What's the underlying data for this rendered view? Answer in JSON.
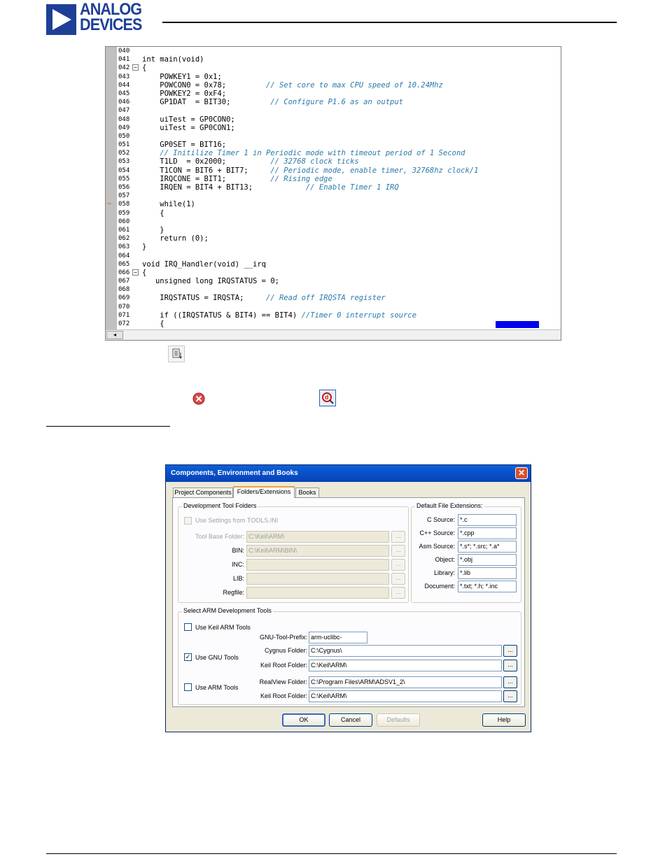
{
  "header": {
    "logo_line1": "ANALOG",
    "logo_line2": "DEVICES",
    "brand_color": "#1e3f96"
  },
  "editor": {
    "lines": [
      {
        "n": "040",
        "fold": "",
        "marker": "",
        "code": ""
      },
      {
        "n": "041",
        "fold": "",
        "marker": "",
        "code": "int main(void)"
      },
      {
        "n": "042",
        "fold": "−",
        "marker": "",
        "code": "{"
      },
      {
        "n": "043",
        "fold": "",
        "marker": "",
        "code": "    POWKEY1 = 0x1;"
      },
      {
        "n": "044",
        "fold": "",
        "marker": "",
        "code": "    POWCON0 = 0x78;         // Set core to max CPU speed of 10.24Mhz"
      },
      {
        "n": "045",
        "fold": "",
        "marker": "",
        "code": "    POWKEY2 = 0xF4;"
      },
      {
        "n": "046",
        "fold": "",
        "marker": "",
        "code": "    GP1DAT  = BIT30;         // Configure P1.6 as an output"
      },
      {
        "n": "047",
        "fold": "",
        "marker": "",
        "code": ""
      },
      {
        "n": "048",
        "fold": "",
        "marker": "",
        "code": "    uiTest = GP0CON0;"
      },
      {
        "n": "049",
        "fold": "",
        "marker": "",
        "code": "    uiTest = GP0CON1;"
      },
      {
        "n": "050",
        "fold": "",
        "marker": "",
        "code": ""
      },
      {
        "n": "051",
        "fold": "",
        "marker": "",
        "code": "    GP0SET = BIT16;"
      },
      {
        "n": "052",
        "fold": "",
        "marker": "",
        "code": "    // Initilize Timer 1 in Periodic mode with timeout period of 1 Second"
      },
      {
        "n": "053",
        "fold": "",
        "marker": "",
        "code": "    T1LD  = 0x2000;          // 32768 clock ticks"
      },
      {
        "n": "054",
        "fold": "",
        "marker": "",
        "code": "    T1CON = BIT6 + BIT7;     // Periodic mode, enable timer, 32768hz clock/1"
      },
      {
        "n": "055",
        "fold": "",
        "marker": "",
        "code": "    IRQCONE = BIT1;          // Rising edge"
      },
      {
        "n": "056",
        "fold": "",
        "marker": "",
        "code": "    IRQEN = BIT4 + BIT13;            // Enable Timer 1 IRQ"
      },
      {
        "n": "057",
        "fold": "",
        "marker": "",
        "code": ""
      },
      {
        "n": "058",
        "fold": "",
        "marker": "⇨",
        "code": "    while(1)"
      },
      {
        "n": "059",
        "fold": "",
        "marker": "",
        "code": "    {"
      },
      {
        "n": "060",
        "fold": "",
        "marker": "",
        "code": ""
      },
      {
        "n": "061",
        "fold": "",
        "marker": "",
        "code": "    }"
      },
      {
        "n": "062",
        "fold": "",
        "marker": "",
        "code": "    return (0);"
      },
      {
        "n": "063",
        "fold": "",
        "marker": "",
        "code": "}"
      },
      {
        "n": "064",
        "fold": "",
        "marker": "",
        "code": ""
      },
      {
        "n": "065",
        "fold": "",
        "marker": "",
        "code": "void IRQ_Handler(void) __irq"
      },
      {
        "n": "066",
        "fold": "−",
        "marker": "",
        "code": "{"
      },
      {
        "n": "067",
        "fold": "",
        "marker": "",
        "code": "   unsigned long IRQSTATUS = 0;"
      },
      {
        "n": "068",
        "fold": "",
        "marker": "",
        "code": ""
      },
      {
        "n": "069",
        "fold": "",
        "marker": "",
        "code": "    IRQSTATUS = IRQSTA;     // Read off IRQSTA register"
      },
      {
        "n": "070",
        "fold": "",
        "marker": "",
        "code": ""
      },
      {
        "n": "071",
        "fold": "",
        "marker": "",
        "code": "    if ((IRQSTATUS & BIT4) == BIT4) //Timer 0 interrupt source"
      },
      {
        "n": "072",
        "fold": "",
        "marker": "",
        "code": "    {"
      }
    ],
    "scroll_left_glyph": "◂"
  },
  "icons": {
    "list_icon": "list-icon",
    "stop_icon": "stop-icon",
    "debug_icon": "debug-icon"
  },
  "dialog": {
    "title": "Components, Environment and Books",
    "close_glyph": "✕",
    "tabs": [
      "Project Components",
      "Folders/Extensions",
      "Books"
    ],
    "active_tab": 1,
    "dev_folders": {
      "title": "Development Tool Folders",
      "use_settings_label": "Use Settings from TOOLS.INI",
      "rows": [
        {
          "label": "Tool Base Folder:",
          "value": "C:\\Keil\\ARM\\"
        },
        {
          "label": "BIN:",
          "value": "C:\\Keil\\ARM\\BIN\\"
        },
        {
          "label": "INC:",
          "value": ""
        },
        {
          "label": "LIB:",
          "value": ""
        },
        {
          "label": "Regfile:",
          "value": ""
        }
      ],
      "browse_label": "..."
    },
    "extensions": {
      "title": "Default File Extensions:",
      "rows": [
        {
          "label": "C Source:",
          "value": "*.c"
        },
        {
          "label": "C++ Source:",
          "value": "*.cpp"
        },
        {
          "label": "Asm Source:",
          "value": "*.s*; *.src; *.a*"
        },
        {
          "label": "Object:",
          "value": "*.obj"
        },
        {
          "label": "Library:",
          "value": "*.lib"
        },
        {
          "label": "Document:",
          "value": "*.txt; *.h; *.inc"
        }
      ]
    },
    "arm_tools": {
      "title": "Select ARM Development Tools",
      "keil_label": "Use Keil ARM Tools",
      "gnu_prefix_label": "GNU-Tool-Prefix:",
      "gnu_prefix_value": "arm-uclibc-",
      "gnu_label": "Use GNU Tools",
      "gnu_checked": "✓",
      "cygnus_label": "Cygnus Folder:",
      "cygnus_value": "C:\\Cygnus\\",
      "keil_root_label": "Keil Root Folder:",
      "keil_root_value": "C:\\Keil\\ARM\\",
      "arm_label": "Use ARM Tools",
      "realview_label": "RealView Folder:",
      "realview_value": "C:\\Program Files\\ARM\\ADSV1_2\\",
      "keil_root2_label": "Keil Root Folder:",
      "keil_root2_value": "C:\\Keil\\ARM\\",
      "browse_label": "..."
    },
    "buttons": {
      "ok": "OK",
      "cancel": "Cancel",
      "defaults": "Defaults",
      "help": "Help"
    }
  }
}
